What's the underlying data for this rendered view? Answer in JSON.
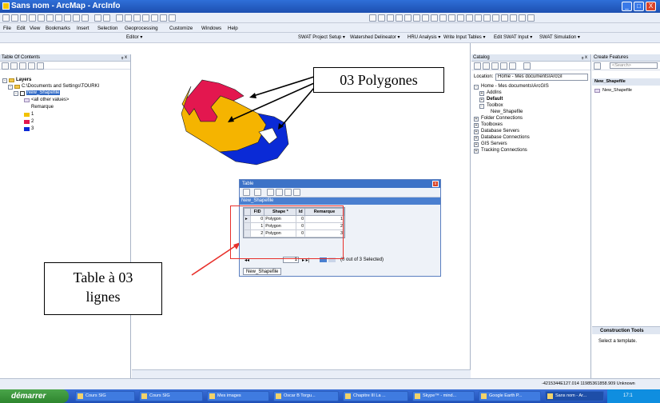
{
  "window": {
    "title": "Sans nom - ArcMap - ArcInfo",
    "controls": {
      "minimize": "_",
      "maximize": "□",
      "close": "X"
    }
  },
  "menu": [
    "File",
    "Edit",
    "View",
    "Bookmarks",
    "Insert",
    "Selection",
    "Geoprocessing",
    "Customize",
    "Windows",
    "Help"
  ],
  "toolbar3": {
    "editor": "Editor ▾",
    "swat": [
      "SWAT Project Setup ▾",
      "Watershed Delineator ▾",
      "HRU Analysis ▾",
      "Write Input Tables ▾",
      "Edit SWAT Input ▾",
      "SWAT Simulation ▾"
    ]
  },
  "toc": {
    "title": "Table Of Contents",
    "pin": "ᵩ x",
    "layers_label": "Layers",
    "path": "C:\\Documents and Settings\\TOURKI",
    "layer": "New_Shapefile",
    "other_values": "<all other values>",
    "field": "Remarque",
    "classes": [
      {
        "label": "1",
        "color": "#f2c200"
      },
      {
        "label": "2",
        "color": "#e3174f"
      },
      {
        "label": "3",
        "color": "#0a2ad6"
      }
    ]
  },
  "annotations": {
    "polygons": "03 Polygones",
    "table_line1": "Table à 03",
    "table_line2": "lignes"
  },
  "table_window": {
    "title": "Table",
    "close": "x",
    "tab_label": "New_Shapefile",
    "columns": [
      "FID",
      "Shape *",
      "Id",
      "Remarque"
    ],
    "rows": [
      [
        "0",
        "Polygon",
        "0",
        "1"
      ],
      [
        "1",
        "Polygon",
        "0",
        "2"
      ],
      [
        "2",
        "Polygon",
        "0",
        "3"
      ]
    ],
    "nav_first": "◂◂",
    "nav_record": "1",
    "nav_next": "▸ ▸|",
    "selection_status": "(0 out of 3 Selected)",
    "bottom_tab": "New_Shapefile"
  },
  "catalog": {
    "title": "Catalog",
    "pin": "ᵩ x",
    "location_label": "Location:",
    "location_value": "Home - Mes documents\\ArcGI",
    "items": [
      "Home - Mes documents\\ArcGIS",
      "AddIns",
      "Default",
      "Toolbox",
      "New_Shapefile",
      "Folder Connections",
      "Toolboxes",
      "Database Servers",
      "Database Connections",
      "GIS Servers",
      "Tracking Connections"
    ]
  },
  "create_features": {
    "title": "Create Features",
    "search_placeholder": "<Search>",
    "list_header": "New_Shapefile",
    "list_item": "New_Shapefile",
    "construction_tools": "Construction Tools",
    "select_template": "Select a template."
  },
  "status": {
    "coords": "-4215344E127.014  11985361858.909 Unknown"
  },
  "taskbar": {
    "start": "démarrer",
    "tasks": [
      "Cours SIG",
      "Cours SIG",
      "Mes images",
      "Oscar B Torgu...",
      "Chapitre III La ...",
      "Skype™ - mind...",
      "Google Earth P...",
      "Sans nom - Ar..."
    ],
    "clock": "17:1"
  }
}
